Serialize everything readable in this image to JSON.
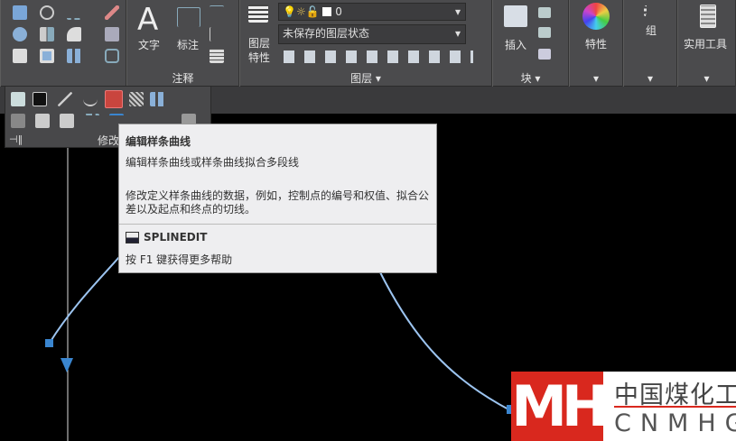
{
  "ribbon": {
    "panels": [
      {
        "title": "注释",
        "buttons": [
          "文字",
          "标注"
        ]
      },
      {
        "title": "图层",
        "buttons": [
          "图层特性"
        ],
        "layer_current": "0",
        "layer_state": "未保存的图层状态"
      },
      {
        "title": "块",
        "buttons": [
          "插入"
        ]
      },
      {
        "title": "",
        "buttons": [
          "特性"
        ]
      },
      {
        "title": "",
        "buttons": [
          "组"
        ]
      },
      {
        "title": "",
        "buttons": [
          "实用工具"
        ]
      }
    ],
    "modify_title": "修改"
  },
  "tooltip": {
    "title": "编辑样条曲线",
    "summary": "编辑样条曲线或样条曲线拟合多段线",
    "description_line1": "修改定义样条曲线的数据，例如，控制点的编号和权值、拟合公",
    "description_line2": "差以及起点和终点的切线。",
    "command": "SPLINEDIT",
    "help": "按 F1 键获得更多帮助"
  },
  "watermark": {
    "cn": "中国煤化工",
    "en": "CNMHG",
    "mark": "MH"
  },
  "colors": {
    "ribbon": "#4b4b4d",
    "spline": "#9cc4f0",
    "highlight": "#d9403a",
    "logo_red": "#d9281e"
  }
}
